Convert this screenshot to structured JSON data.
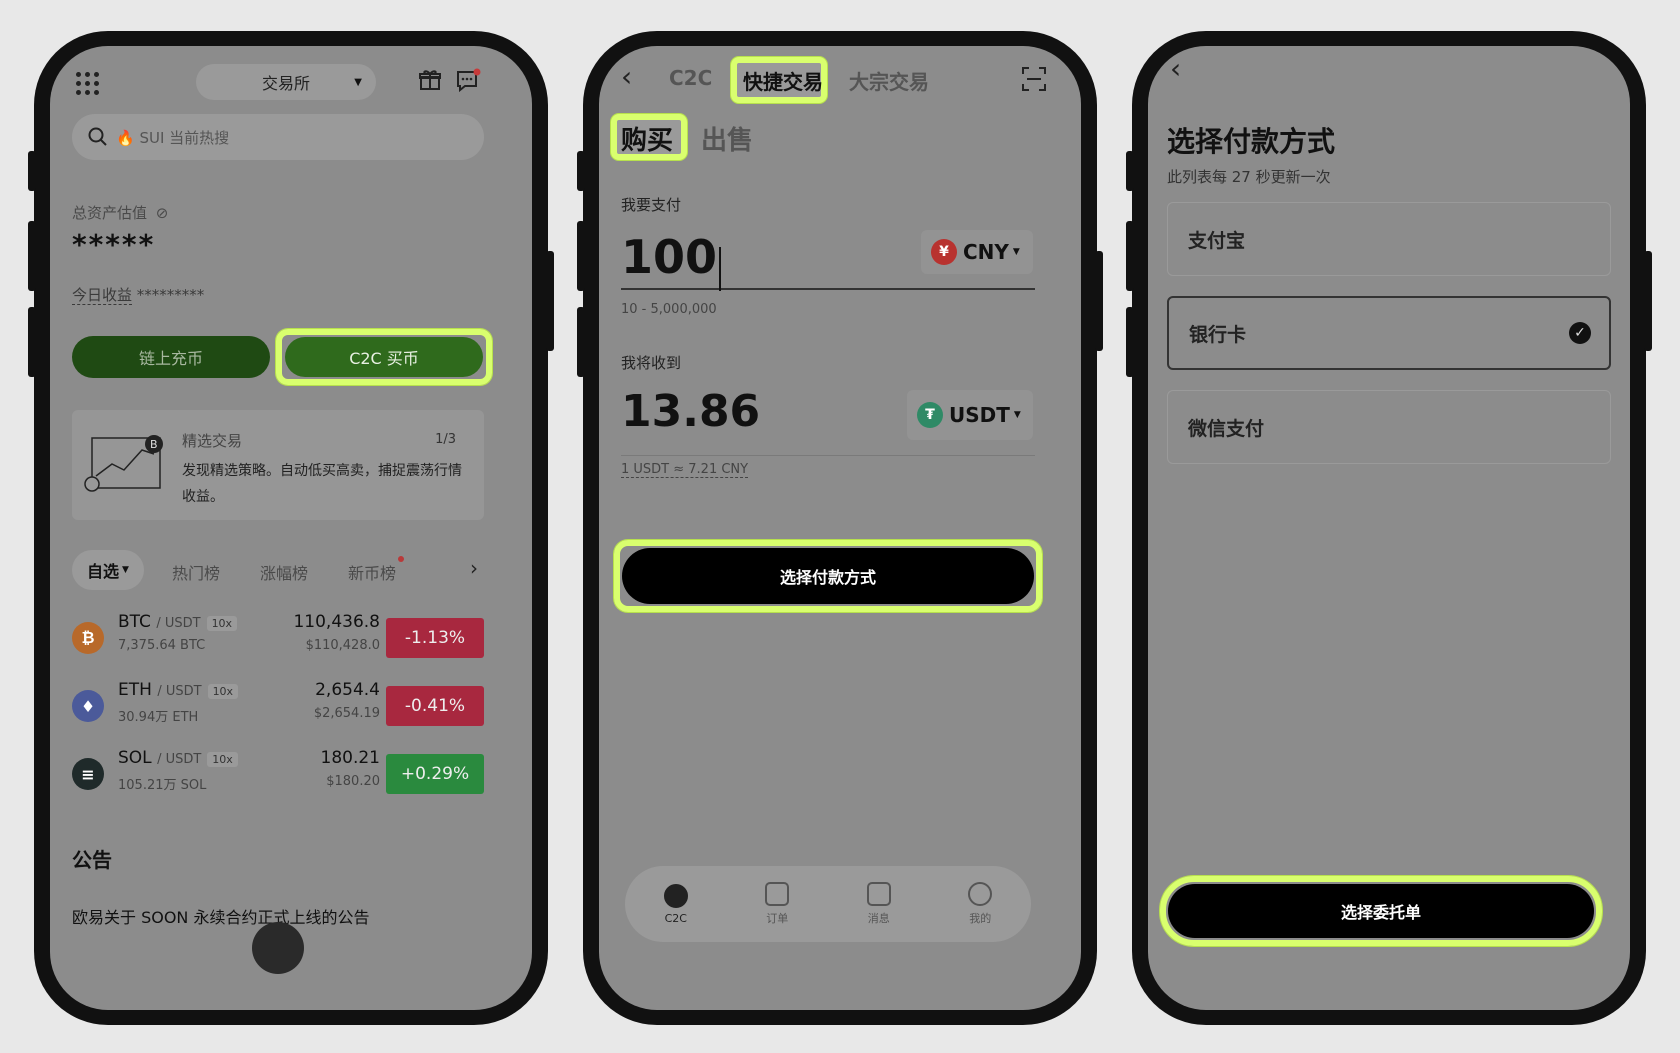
{
  "phone1": {
    "top_switch": "交易所",
    "search_placeholder": "🔥 SUI 当前热搜",
    "assets_label": "总资产估值",
    "assets_value": "*****",
    "today_label": "今日收益",
    "today_value": "*********",
    "btn_onchain": "链上充币",
    "btn_c2c": "C2C 买币",
    "feature_title": "精选交易",
    "feature_page": "1/3",
    "feature_desc": "发现精选策略。自动低买高卖，捕捉震荡行情收益。",
    "tabs": [
      "自选",
      "热门榜",
      "涨幅榜",
      "新币榜"
    ],
    "markets": [
      {
        "symbol": "BTC",
        "quote": "/ USDT",
        "lev": "10x",
        "vol": "7,375.64 BTC",
        "price": "110,436.8",
        "fiat": "$110,428.0",
        "change": "-1.13%",
        "coin_color": "#b8692a",
        "chg_color": "#a8283f"
      },
      {
        "symbol": "ETH",
        "quote": "/ USDT",
        "lev": "10x",
        "vol": "30.94万 ETH",
        "price": "2,654.4",
        "fiat": "$2,654.19",
        "change": "-0.41%",
        "coin_color": "#4b5a9a",
        "chg_color": "#a8283f"
      },
      {
        "symbol": "SOL",
        "quote": "/ USDT",
        "lev": "10x",
        "vol": "105.21万 SOL",
        "price": "180.21",
        "fiat": "$180.20",
        "change": "+0.29%",
        "coin_color": "#1f2a2a",
        "chg_color": "#2a8a3e"
      }
    ],
    "announce_title": "公告",
    "announce_item": "欧易关于 SOON 永续合约正式上线的公告"
  },
  "phone2": {
    "tab_c2c": "C2C",
    "tab_quick": "快捷交易",
    "tab_bulk": "大宗交易",
    "buy": "购买",
    "sell": "出售",
    "pay_label": "我要支付",
    "pay_value": "100",
    "pay_currency": "CNY",
    "pay_range": "10 - 5,000,000",
    "receive_label": "我将收到",
    "receive_value": "13.86",
    "receive_currency": "USDT",
    "rate": "1 USDT ≈ 7.21 CNY",
    "select_btn": "选择付款方式",
    "tabbar": [
      "C2C",
      "订单",
      "消息",
      "我的"
    ]
  },
  "phone3": {
    "title": "选择付款方式",
    "subtitle": "此列表每 27 秒更新一次",
    "options": [
      "支付宝",
      "银行卡",
      "微信支付"
    ],
    "select_order": "选择委托单"
  }
}
